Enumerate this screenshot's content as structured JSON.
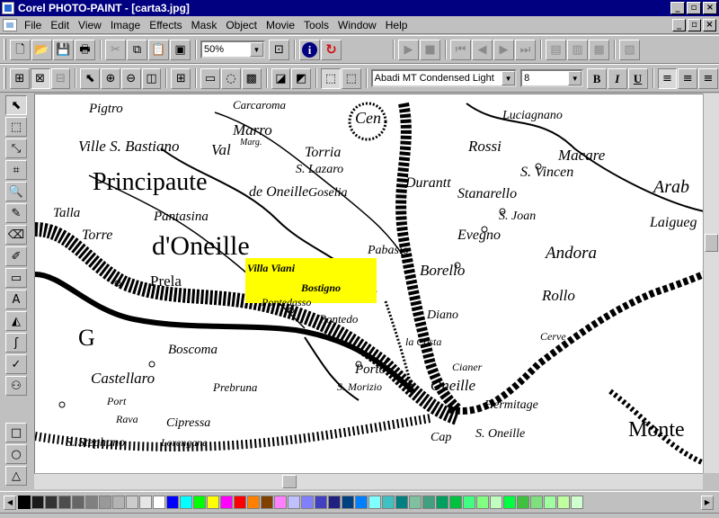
{
  "window": {
    "title": "Corel PHOTO-PAINT - [carta3.jpg]",
    "caption_buttons": [
      "_",
      "▫",
      "×"
    ]
  },
  "menu": {
    "items": [
      "File",
      "Edit",
      "View",
      "Image",
      "Effects",
      "Mask",
      "Object",
      "Movie",
      "Tools",
      "Window",
      "Help"
    ],
    "doc_buttons": [
      "_",
      "▫",
      "×"
    ]
  },
  "toolbar1": {
    "zoom": "50%"
  },
  "toolbar2": {
    "font_name": "Abadi MT Condensed Light",
    "font_size": "8",
    "bold": "B",
    "italic": "I",
    "underline": "U"
  },
  "map": {
    "labels": [
      "Pigtro",
      "Carcaroma",
      "Marro",
      "Marg.",
      "Cen",
      "Luciagnano",
      "Ville S. Bastiano",
      "Val",
      "Torria",
      "S. Lazaro",
      "Rossi",
      "Macare",
      "Principaute",
      "de Oneille",
      "Durantt",
      "S. Vincen",
      "Arab",
      "Goselia",
      "Stanarello",
      "Talla",
      "Pantasina",
      "S. Joan",
      "Laigueg",
      "Torre",
      "Evegno",
      "Andora",
      "d'Oneille",
      "Pabasio",
      "Borello",
      "Prela",
      "Rollo",
      "Diano",
      "Cerve",
      "G",
      "Boscoma",
      "la Costa",
      "Castellaro",
      "Porto",
      "S. Morizio",
      "Oneille",
      "Cianer",
      "Pontedasso",
      "Prebruna",
      "Hermitage",
      "Port",
      "Rava",
      "Cipressa",
      "S. Stephano",
      "Lorengane",
      "Cap",
      "S. Oneille",
      "Monte",
      "Pontedo"
    ],
    "highlight_labels": [
      "Villa Viani",
      "Bostigno"
    ],
    "highlight_color": "#ffff00"
  },
  "palette": {
    "colors": [
      "#000000",
      "#1a1a1a",
      "#333333",
      "#4d4d4d",
      "#666666",
      "#808080",
      "#999999",
      "#b3b3b3",
      "#cccccc",
      "#e6e6e6",
      "#ffffff",
      "#0000ff",
      "#00ffff",
      "#00ff00",
      "#ffff00",
      "#ff00ff",
      "#ff0000",
      "#ff8000",
      "#804000",
      "#ff80ff",
      "#c0c0ff",
      "#8080ff",
      "#4040c0",
      "#202080",
      "#004080",
      "#0080ff",
      "#80ffff",
      "#40c0c0",
      "#008080",
      "#80c0a0",
      "#40a080",
      "#00a060",
      "#00c040",
      "#40ff80",
      "#80ff80",
      "#c0ffc0",
      "#00ff40",
      "#40c040",
      "#80e080",
      "#a0ffa0",
      "#c0ffa0",
      "#d0ffd0"
    ]
  }
}
